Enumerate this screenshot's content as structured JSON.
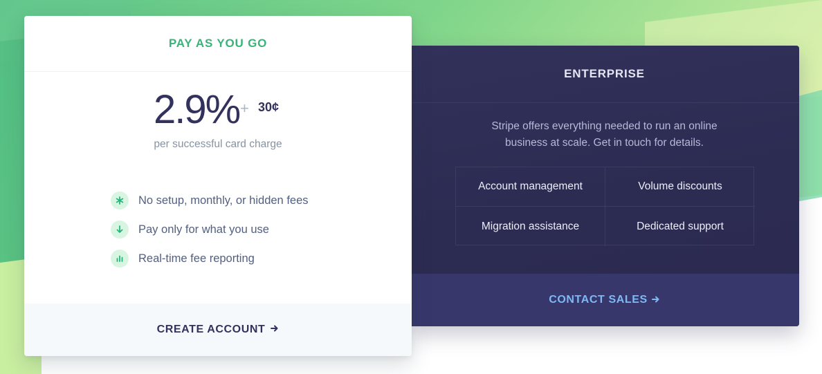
{
  "colors": {
    "accent_green": "#3ab27a",
    "navy": "#32325d",
    "enterprise_bg": "#2c2b52",
    "contact_link": "#7fb8f5"
  },
  "payg": {
    "title": "PAY AS YOU GO",
    "price_percent": "2.9%",
    "price_plus": "+",
    "price_fixed": "30¢",
    "price_caption": "per successful card charge",
    "features": [
      {
        "icon": "star-icon",
        "label": "No setup, monthly, or hidden fees"
      },
      {
        "icon": "arrow-down-icon",
        "label": "Pay only for what you use"
      },
      {
        "icon": "bar-chart-icon",
        "label": "Real-time fee reporting"
      }
    ],
    "cta_label": "CREATE ACCOUNT",
    "cta_icon": "arrow-right-icon"
  },
  "enterprise": {
    "title": "ENTERPRISE",
    "description": "Stripe offers everything needed to run an online business at scale. Get in touch for details.",
    "features": [
      "Account management",
      "Volume discounts",
      "Migration assistance",
      "Dedicated support"
    ],
    "cta_label": "CONTACT SALES",
    "cta_icon": "arrow-right-icon"
  }
}
